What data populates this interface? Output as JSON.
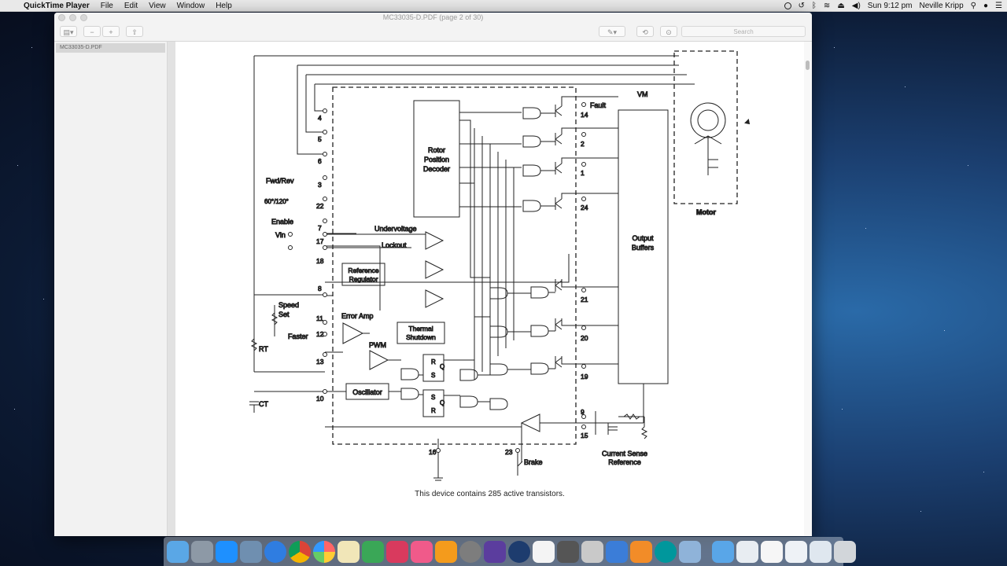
{
  "menubar": {
    "app_name": "QuickTime Player",
    "menus": [
      "File",
      "Edit",
      "View",
      "Window",
      "Help"
    ],
    "clock": "Sun 9:12 pm",
    "user": "Neville Kripp"
  },
  "window": {
    "title": "MC33035-D.PDF (page 2 of 30)",
    "search_placeholder": "Search",
    "sidebar_items": [
      "MC33035-D.PDF"
    ]
  },
  "schematic": {
    "labels": {
      "fault": "Fault",
      "vm": "VM",
      "motor": "Motor",
      "rotor_decoder_1": "Rotor",
      "rotor_decoder_2": "Position",
      "rotor_decoder_3": "Decoder",
      "fwd_rev": "Fwd/Rev",
      "sixty_120": "60°/120°",
      "enable": "Enable",
      "vin": "Vin",
      "undervoltage": "Undervoltage",
      "lockout": "Lockout",
      "ref_reg_1": "Reference",
      "ref_reg_2": "Regulator",
      "speed_set_1": "Speed",
      "speed_set_2": "Set",
      "faster": "Faster",
      "error_amp": "Error Amp",
      "pwm": "PWM",
      "thermal_1": "Thermal",
      "thermal_2": "Shutdown",
      "output_buffers_1": "Output",
      "output_buffers_2": "Buffers",
      "oscillator": "Oscillator",
      "rt": "RT",
      "ct": "CT",
      "brake": "Brake",
      "current_sense_1": "Current Sense",
      "current_sense_2": "Reference",
      "r": "R",
      "s": "S",
      "q": "Q"
    },
    "pins": [
      "4",
      "5",
      "6",
      "3",
      "22",
      "7",
      "17",
      "18",
      "8",
      "11",
      "12",
      "13",
      "10",
      "16",
      "23",
      "14",
      "2",
      "1",
      "24",
      "21",
      "20",
      "19",
      "9",
      "15"
    ],
    "caption": "This device contains 285 active transistors."
  },
  "dock": {
    "apps": [
      "Finder",
      "Launchpad",
      "App Store",
      "Preview",
      "Safari",
      "Chrome",
      "Photos",
      "Notes",
      "Numbers",
      "Messages",
      "iTunes",
      "iBooks",
      "System Preferences",
      "iMovie",
      "QuickTime Player",
      "TextEdit",
      "Calculator",
      "Database",
      "Xcode",
      "Fusion 360",
      "Arduino",
      "Photos Import"
    ],
    "right_items": [
      "Documents",
      "Downloads",
      "File 1",
      "File 2",
      "File 3",
      "Trash"
    ]
  }
}
